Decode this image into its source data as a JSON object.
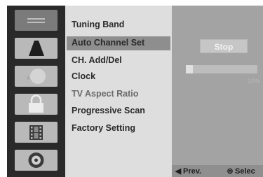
{
  "sidebar": {
    "icons": [
      {
        "name": "general-setup-icon",
        "selected": true
      },
      {
        "name": "language-icon",
        "selected": false
      },
      {
        "name": "audio-icon",
        "selected": false
      },
      {
        "name": "lock-icon",
        "selected": false
      },
      {
        "name": "recording-icon",
        "selected": false
      },
      {
        "name": "disc-icon",
        "selected": false
      }
    ]
  },
  "menu": {
    "items": [
      {
        "label": "Tuning Band",
        "state": "normal"
      },
      {
        "label": "Auto Channel Set",
        "state": "highlighted"
      },
      {
        "label": "CH. Add/Del",
        "state": "normal"
      },
      {
        "label": "Clock",
        "state": "normal"
      },
      {
        "label": "TV Aspect Ratio",
        "state": "dim"
      },
      {
        "label": "Progressive Scan",
        "state": "normal"
      },
      {
        "label": "Factory Setting",
        "state": "normal"
      }
    ]
  },
  "panel": {
    "stop_label": "Stop",
    "progress_percent": 10,
    "progress_text": "10%"
  },
  "footer": {
    "prev_icon": "◀",
    "prev_label": "Prev.",
    "select_icon": "⊚",
    "select_label": "Selec"
  }
}
